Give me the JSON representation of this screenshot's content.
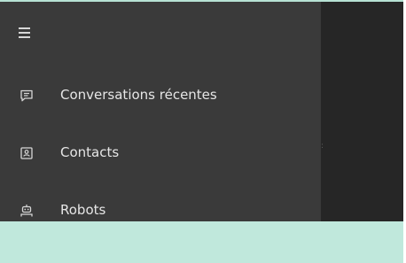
{
  "menu": {
    "toggle_icon": "hamburger-menu-icon"
  },
  "nav": {
    "items": [
      {
        "label": "Conversations récentes",
        "icon": "chat-icon"
      },
      {
        "label": "Contacts",
        "icon": "contact-card-icon"
      },
      {
        "label": "Robots",
        "icon": "robot-icon"
      }
    ]
  },
  "colors": {
    "drawer_bg": "#3a3a3a",
    "content_bg": "#262626",
    "accent_bar": "#c0e8dc",
    "text": "#e6e6e6"
  }
}
